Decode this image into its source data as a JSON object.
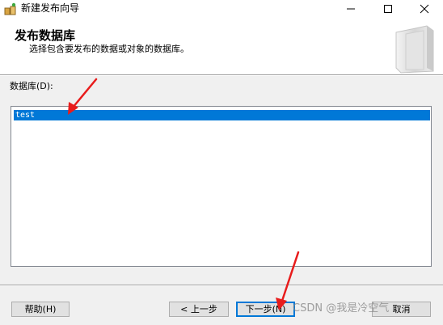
{
  "window": {
    "title": "新建发布向导",
    "controls": [
      "minimize-icon",
      "maximize-icon",
      "close-icon"
    ]
  },
  "header": {
    "title": "发布数据库",
    "subtitle": "选择包含要发布的数据或对象的数据库。"
  },
  "database_list": {
    "label": "数据库(D):",
    "items": [
      {
        "name": "test",
        "selected": true
      }
    ]
  },
  "buttons": {
    "help": "帮助(H)",
    "back": "< 上一步",
    "next": "下一步(N)",
    "cancel": "取消"
  },
  "watermark": "CSDN @我是冷空气",
  "colors": {
    "selection": "#0078d7",
    "annotation_arrow": "#e81c1c"
  }
}
